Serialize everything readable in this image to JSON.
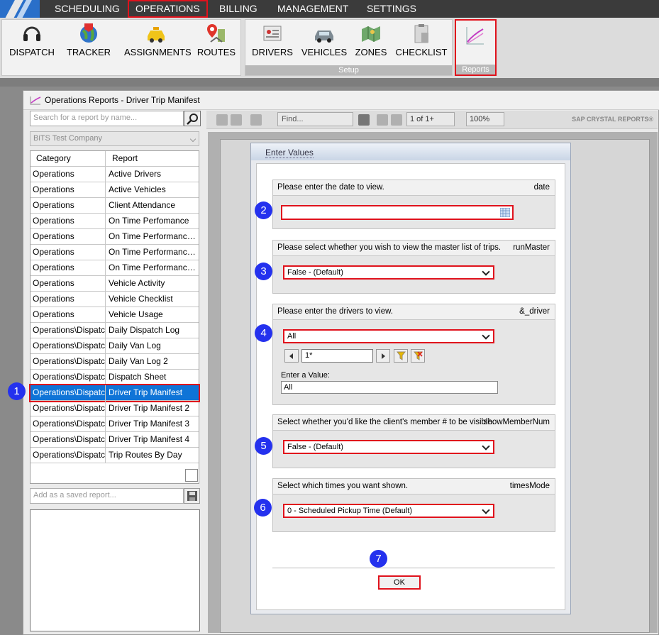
{
  "menu": {
    "items": [
      "SCHEDULING",
      "OPERATIONS",
      "BILLING",
      "MANAGEMENT",
      "SETTINGS"
    ],
    "active": "OPERATIONS"
  },
  "ribbon": {
    "main": [
      "DISPATCH",
      "TRACKER",
      "ASSIGNMENTS",
      "ROUTES"
    ],
    "setup": [
      "DRIVERS",
      "VEHICLES",
      "ZONES",
      "CHECKLIST"
    ],
    "setup_label": "Setup",
    "reports_label": "Reports"
  },
  "window": {
    "title": "Operations Reports - Driver Trip Manifest"
  },
  "left": {
    "search_placeholder": "Search for a report by name...",
    "company": "BiTS Test Company",
    "col_category": "Category",
    "col_report": "Report",
    "rows": [
      [
        "Operations",
        "Active Drivers"
      ],
      [
        "Operations",
        "Active Vehicles"
      ],
      [
        "Operations",
        "Client Attendance"
      ],
      [
        "Operations",
        "On Time Perfomance"
      ],
      [
        "Operations",
        "On Time Performance B..."
      ],
      [
        "Operations",
        "On Time Performance B..."
      ],
      [
        "Operations",
        "On Time Performance B..."
      ],
      [
        "Operations",
        "Vehicle Activity"
      ],
      [
        "Operations",
        "Vehicle Checklist"
      ],
      [
        "Operations",
        "Vehicle Usage"
      ],
      [
        "Operations\\Dispatch",
        "Daily Dispatch Log"
      ],
      [
        "Operations\\Dispatch",
        "Daily Van Log"
      ],
      [
        "Operations\\Dispatch",
        "Daily Van Log 2"
      ],
      [
        "Operations\\Dispatch",
        "Dispatch Sheet"
      ],
      [
        "Operations\\Dispatch",
        "Driver Trip Manifest"
      ],
      [
        "Operations\\Dispatch",
        "Driver Trip Manifest 2"
      ],
      [
        "Operations\\Dispatch",
        "Driver Trip Manifest 3"
      ],
      [
        "Operations\\Dispatch",
        "Driver Trip Manifest 4"
      ],
      [
        "Operations\\Dispatch",
        "Trip Routes By Day"
      ]
    ],
    "selected_index": 14,
    "saved_placeholder": "Add as a saved report..."
  },
  "toolbar": {
    "find_placeholder": "Find...",
    "page": "1 of 1+",
    "zoom": "100%",
    "brand": "SAP CRYSTAL REPORTS®"
  },
  "dialog": {
    "title": "Enter Values",
    "params": [
      {
        "prompt": "Please enter the date to view.",
        "name": "date",
        "value": ""
      },
      {
        "prompt": "Please select whether you wish to view the master list of trips.",
        "name": "runMaster",
        "value": "False - (Default)"
      },
      {
        "prompt": "Please enter the drivers to view.",
        "name": "&_driver",
        "value": "All",
        "index": "1*",
        "enter_label": "Enter a Value:",
        "enter_value": "All"
      },
      {
        "prompt": "Select whether you'd like the client's member # to be visible.",
        "name": "showMemberNum",
        "value": "False - (Default)"
      },
      {
        "prompt": "Select which times you want shown.",
        "name": "timesMode",
        "value": "0 - Scheduled Pickup Time (Default)"
      }
    ],
    "ok_label": "OK"
  },
  "badges": [
    "1",
    "2",
    "3",
    "4",
    "5",
    "6",
    "7"
  ],
  "colors": {
    "highlight": "#e0121c",
    "badge": "#2431ee",
    "selected_row": "#0f74d7"
  }
}
